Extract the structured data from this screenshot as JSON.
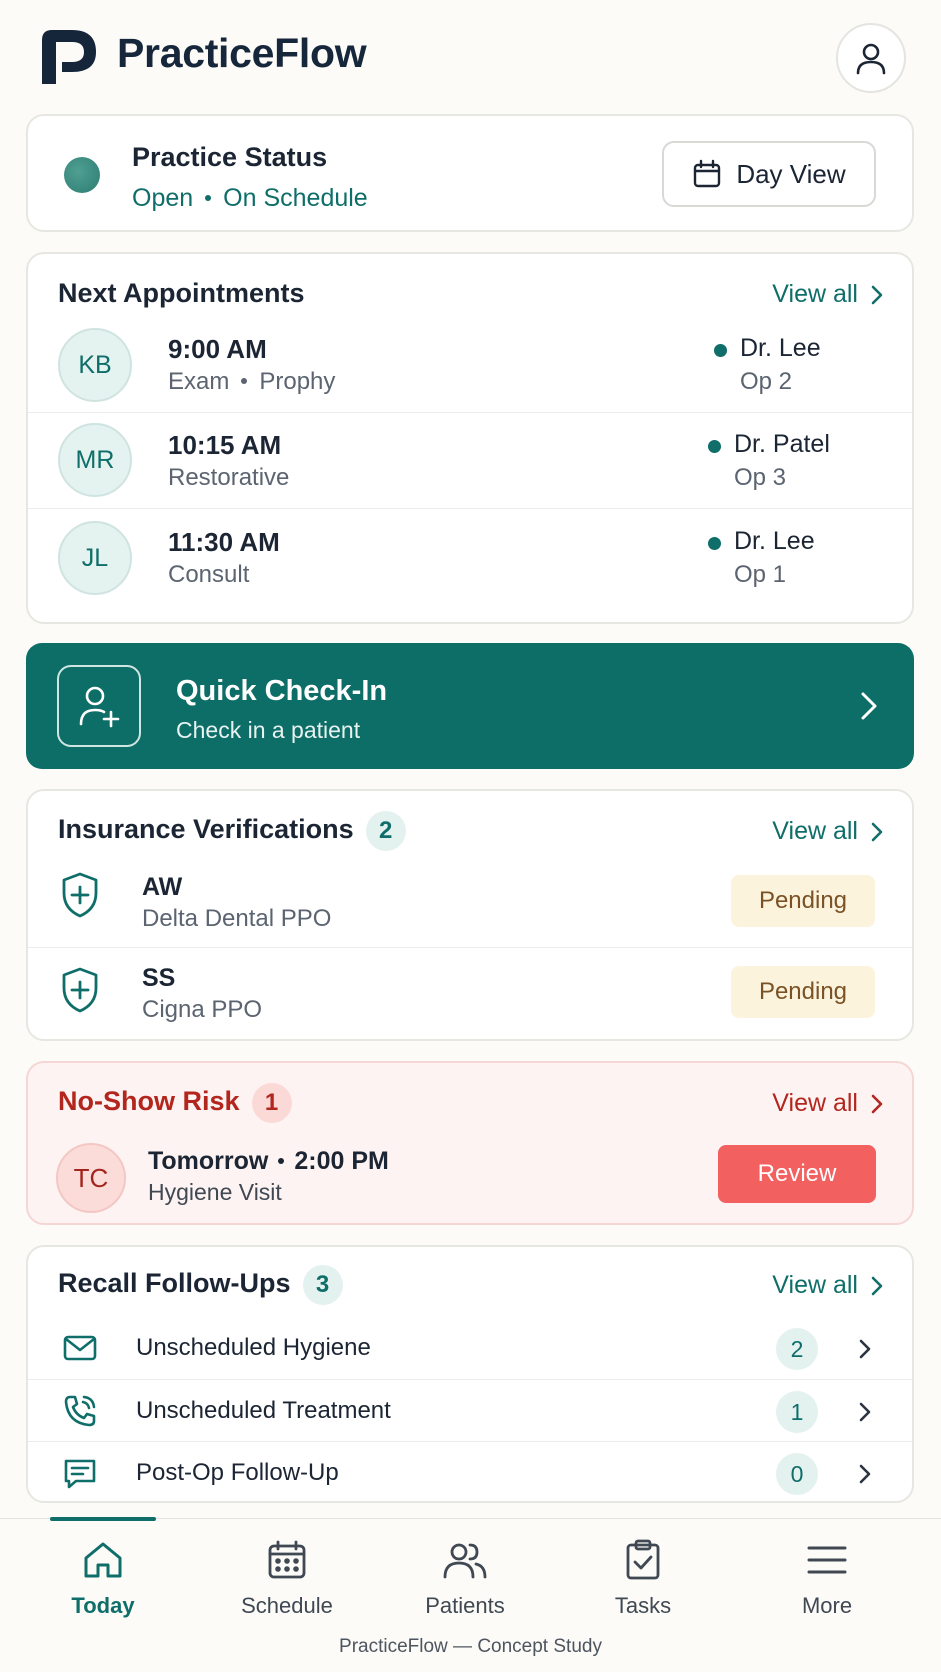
{
  "app": {
    "name": "PracticeFlow"
  },
  "status": {
    "title": "Practice Status",
    "state": "Open",
    "schedule": "On Schedule",
    "day_view_label": "Day View"
  },
  "appointments": {
    "title": "Next Appointments",
    "view_all": "View all",
    "items": [
      {
        "initials": "KB",
        "time": "9:00 AM",
        "type": "Exam",
        "type2": "Prophy",
        "doctor": "Dr. Lee",
        "op": "Op 2"
      },
      {
        "initials": "MR",
        "time": "10:15 AM",
        "type": "Restorative",
        "type2": "",
        "doctor": "Dr. Patel",
        "op": "Op 3"
      },
      {
        "initials": "JL",
        "time": "11:30 AM",
        "type": "Consult",
        "type2": "",
        "doctor": "Dr. Lee",
        "op": "Op 1"
      }
    ]
  },
  "checkin": {
    "title": "Quick Check-In",
    "subtitle": "Check in a patient"
  },
  "insurance": {
    "title": "Insurance Verifications",
    "count": "2",
    "view_all": "View all",
    "items": [
      {
        "initials": "AW",
        "plan": "Delta Dental PPO",
        "status": "Pending"
      },
      {
        "initials": "SS",
        "plan": "Cigna PPO",
        "status": "Pending"
      }
    ]
  },
  "noshow": {
    "title": "No-Show Risk",
    "count": "1",
    "view_all": "View all",
    "initials": "TC",
    "day": "Tomorrow",
    "time": "2:00 PM",
    "visit": "Hygiene Visit",
    "review_label": "Review"
  },
  "recall": {
    "title": "Recall Follow-Ups",
    "count": "3",
    "view_all": "View all",
    "items": [
      {
        "label": "Unscheduled Hygiene",
        "count": "2",
        "icon": "mail-icon"
      },
      {
        "label": "Unscheduled Treatment",
        "count": "1",
        "icon": "phone-icon"
      },
      {
        "label": "Post-Op Follow-Up",
        "count": "0",
        "icon": "message-icon"
      }
    ]
  },
  "nav": {
    "items": [
      {
        "label": "Today",
        "icon": "home-icon",
        "active": true
      },
      {
        "label": "Schedule",
        "icon": "calendar-icon"
      },
      {
        "label": "Patients",
        "icon": "users-icon"
      },
      {
        "label": "Tasks",
        "icon": "clipboard-check-icon"
      },
      {
        "label": "More",
        "icon": "menu-icon"
      }
    ]
  },
  "footer": "PracticeFlow — Concept Study",
  "colors": {
    "accent": "#0f6e69",
    "danger": "#b3261e",
    "review": "#f26060",
    "pending_bg": "#fcf3dd"
  }
}
